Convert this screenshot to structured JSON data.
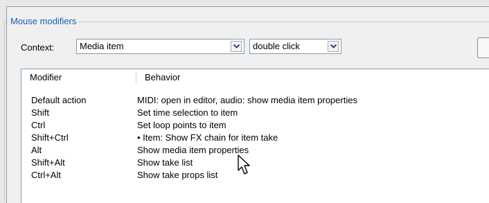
{
  "group": {
    "title": "Mouse modifiers"
  },
  "context": {
    "label": "Context:",
    "selected": "Media item",
    "action_selected": "double click"
  },
  "list": {
    "columns": [
      "Modifier",
      "Behavior"
    ],
    "rows": [
      {
        "modifier": "Default action",
        "behavior": "MIDI: open in editor, audio: show media item properties"
      },
      {
        "modifier": "Shift",
        "behavior": "Set time selection to item"
      },
      {
        "modifier": "Ctrl",
        "behavior": "Set loop points to item"
      },
      {
        "modifier": "Shift+Ctrl",
        "behavior": "• Item: Show FX chain for item take"
      },
      {
        "modifier": "Alt",
        "behavior": "Show media item properties"
      },
      {
        "modifier": "Shift+Alt",
        "behavior": "Show take list"
      },
      {
        "modifier": "Ctrl+Alt",
        "behavior": "Show take props list"
      }
    ]
  },
  "icons": {
    "dropdown": "chevron-down-icon",
    "cursor": "mouse-pointer-icon"
  }
}
